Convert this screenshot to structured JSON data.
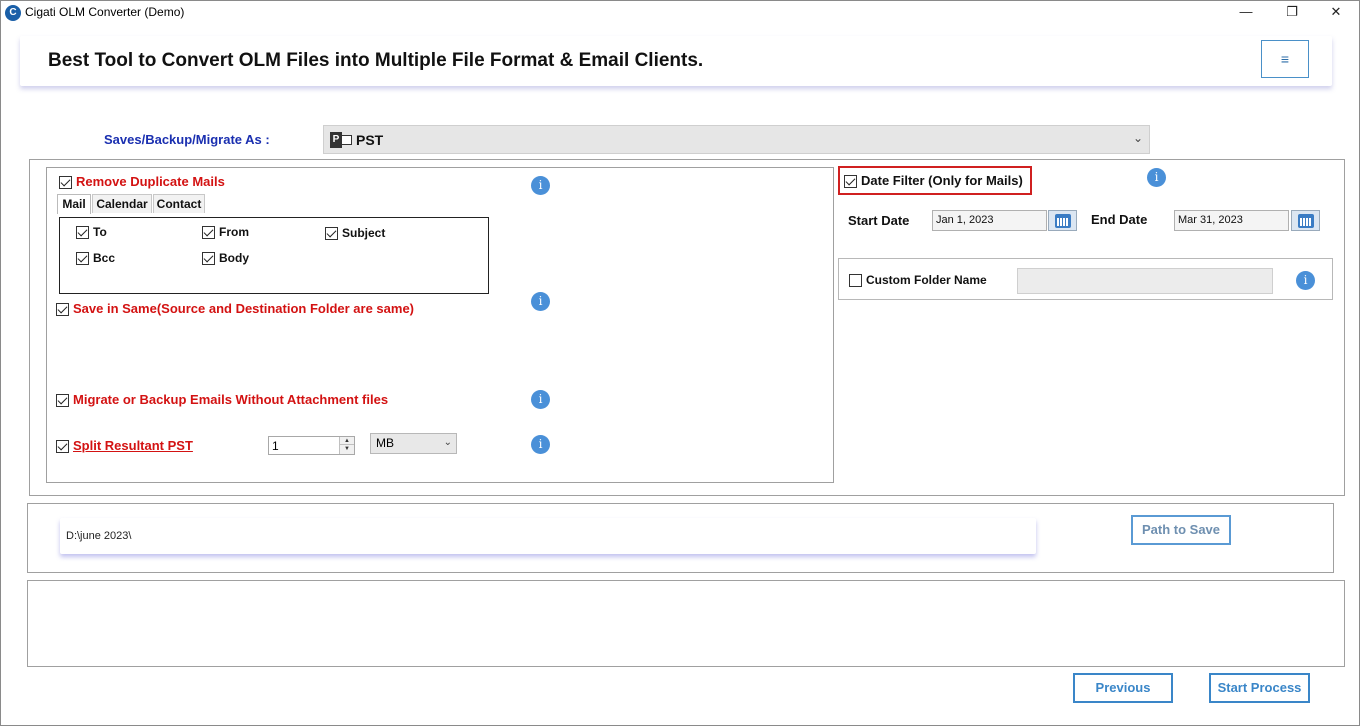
{
  "window": {
    "title": "Cigati OLM Converter (Demo)",
    "minimize_glyph": "—",
    "maximize_glyph": "❐",
    "close_glyph": "✕"
  },
  "header": {
    "title": "Best Tool to Convert OLM Files into Multiple File Format & Email Clients.",
    "menu_glyph": "≡"
  },
  "save_as": {
    "label": "Saves/Backup/Migrate As :",
    "selected": "PST",
    "icon": "outlook-pst-icon"
  },
  "left_options": {
    "remove_duplicates": {
      "label": "Remove Duplicate Mails",
      "checked": true
    },
    "tabs": [
      {
        "label": "Mail",
        "active": true
      },
      {
        "label": "Calendar",
        "active": false
      },
      {
        "label": "Contact",
        "active": false
      }
    ],
    "mail_fields": [
      {
        "label": "To",
        "checked": true
      },
      {
        "label": "From",
        "checked": true
      },
      {
        "label": "Subject",
        "checked": true
      },
      {
        "label": "Bcc",
        "checked": true
      },
      {
        "label": "Body",
        "checked": true
      }
    ],
    "save_in_same": {
      "label": "Save in Same(Source and Destination Folder are same)",
      "checked": true
    },
    "without_attachments": {
      "label": "Migrate or Backup Emails Without Attachment files",
      "checked": true
    },
    "split_pst": {
      "label": "Split Resultant PST",
      "checked": true,
      "value": "1",
      "unit": "MB"
    }
  },
  "right_options": {
    "date_filter": {
      "label": "Date Filter  (Only for Mails)",
      "checked": true
    },
    "start_date": {
      "label": "Start Date",
      "value": "Jan 1, 2023"
    },
    "end_date": {
      "label": "End Date",
      "value": "Mar 31, 2023"
    },
    "custom_folder": {
      "label": "Custom Folder Name",
      "checked": false,
      "value": ""
    }
  },
  "info_glyph": "i",
  "path": {
    "value": "D:\\june 2023\\",
    "button": "Path to Save"
  },
  "footer": {
    "previous": "Previous",
    "start": "Start Process"
  },
  "colors": {
    "accent_blue": "#3a86c8",
    "option_red": "#d31212",
    "label_blue": "#1a2fb0",
    "info_blue": "#4a90d8"
  }
}
